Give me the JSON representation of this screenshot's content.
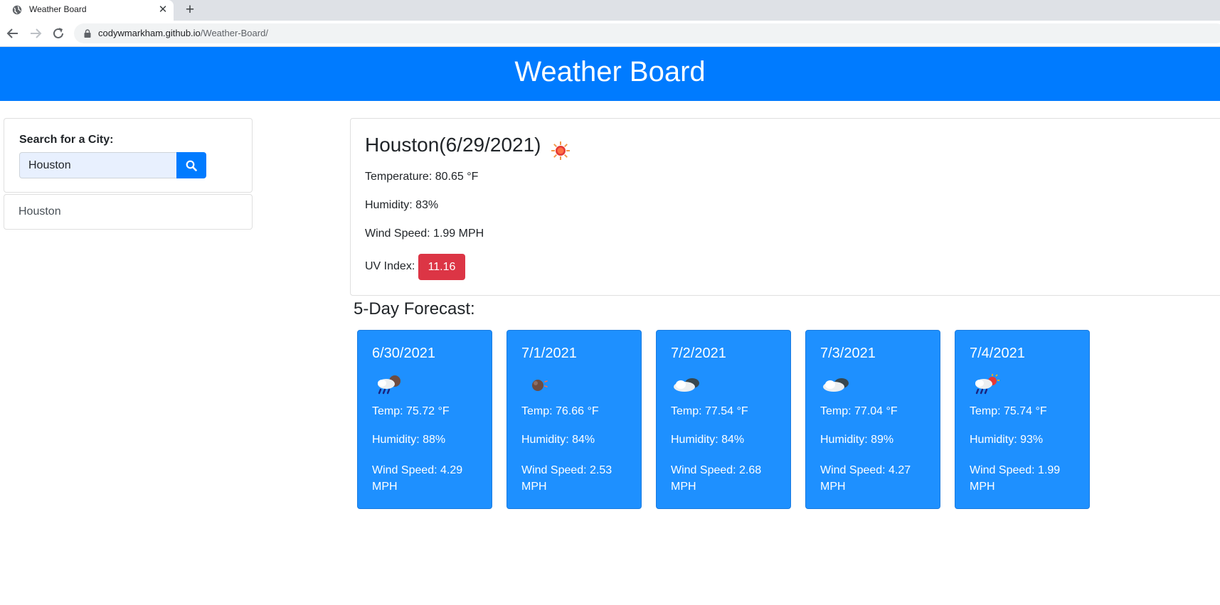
{
  "browser": {
    "tab_title": "Weather Board",
    "tab_close": "✕",
    "new_tab": "+",
    "url_host": "codywmarkham.github.io",
    "url_path": "/Weather-Board/"
  },
  "header": {
    "title": "Weather Board"
  },
  "search": {
    "label": "Search for a City:",
    "value": "Houston",
    "button_icon": "search-icon"
  },
  "history": [
    "Houston"
  ],
  "current": {
    "heading": "Houston(6/29/2021)",
    "icon": "sun-icon",
    "temperature": "Temperature: 80.65 °F",
    "humidity": "Humidity: 83%",
    "wind": "Wind Speed: 1.99 MPH",
    "uv_label": "UV Index:",
    "uv_value": "11.16",
    "uv_color": "#dc3545"
  },
  "forecast": {
    "heading": "5-Day Forecast:",
    "days": [
      {
        "date": "6/30/2021",
        "icon": "rain-cloud-moon-icon",
        "temp": "Temp: 75.72 °F",
        "humidity": "Humidity: 88%",
        "wind": "Wind Speed: 4.29 MPH"
      },
      {
        "date": "7/1/2021",
        "icon": "moon-icon",
        "temp": "Temp: 76.66 °F",
        "humidity": "Humidity: 84%",
        "wind": "Wind Speed: 2.53 MPH"
      },
      {
        "date": "7/2/2021",
        "icon": "cloud-icon",
        "temp": "Temp: 77.54 °F",
        "humidity": "Humidity: 84%",
        "wind": "Wind Speed: 2.68 MPH"
      },
      {
        "date": "7/3/2021",
        "icon": "cloud-icon",
        "temp": "Temp: 77.04 °F",
        "humidity": "Humidity: 89%",
        "wind": "Wind Speed: 4.27 MPH"
      },
      {
        "date": "7/4/2021",
        "icon": "rain-cloud-sun-icon",
        "temp": "Temp: 75.74 °F",
        "humidity": "Humidity: 93%",
        "wind": "Wind Speed: 1.99 MPH"
      }
    ]
  },
  "colors": {
    "header_bg": "#007bff",
    "forecast_bg": "#1e90ff",
    "search_button": "#007bff"
  }
}
